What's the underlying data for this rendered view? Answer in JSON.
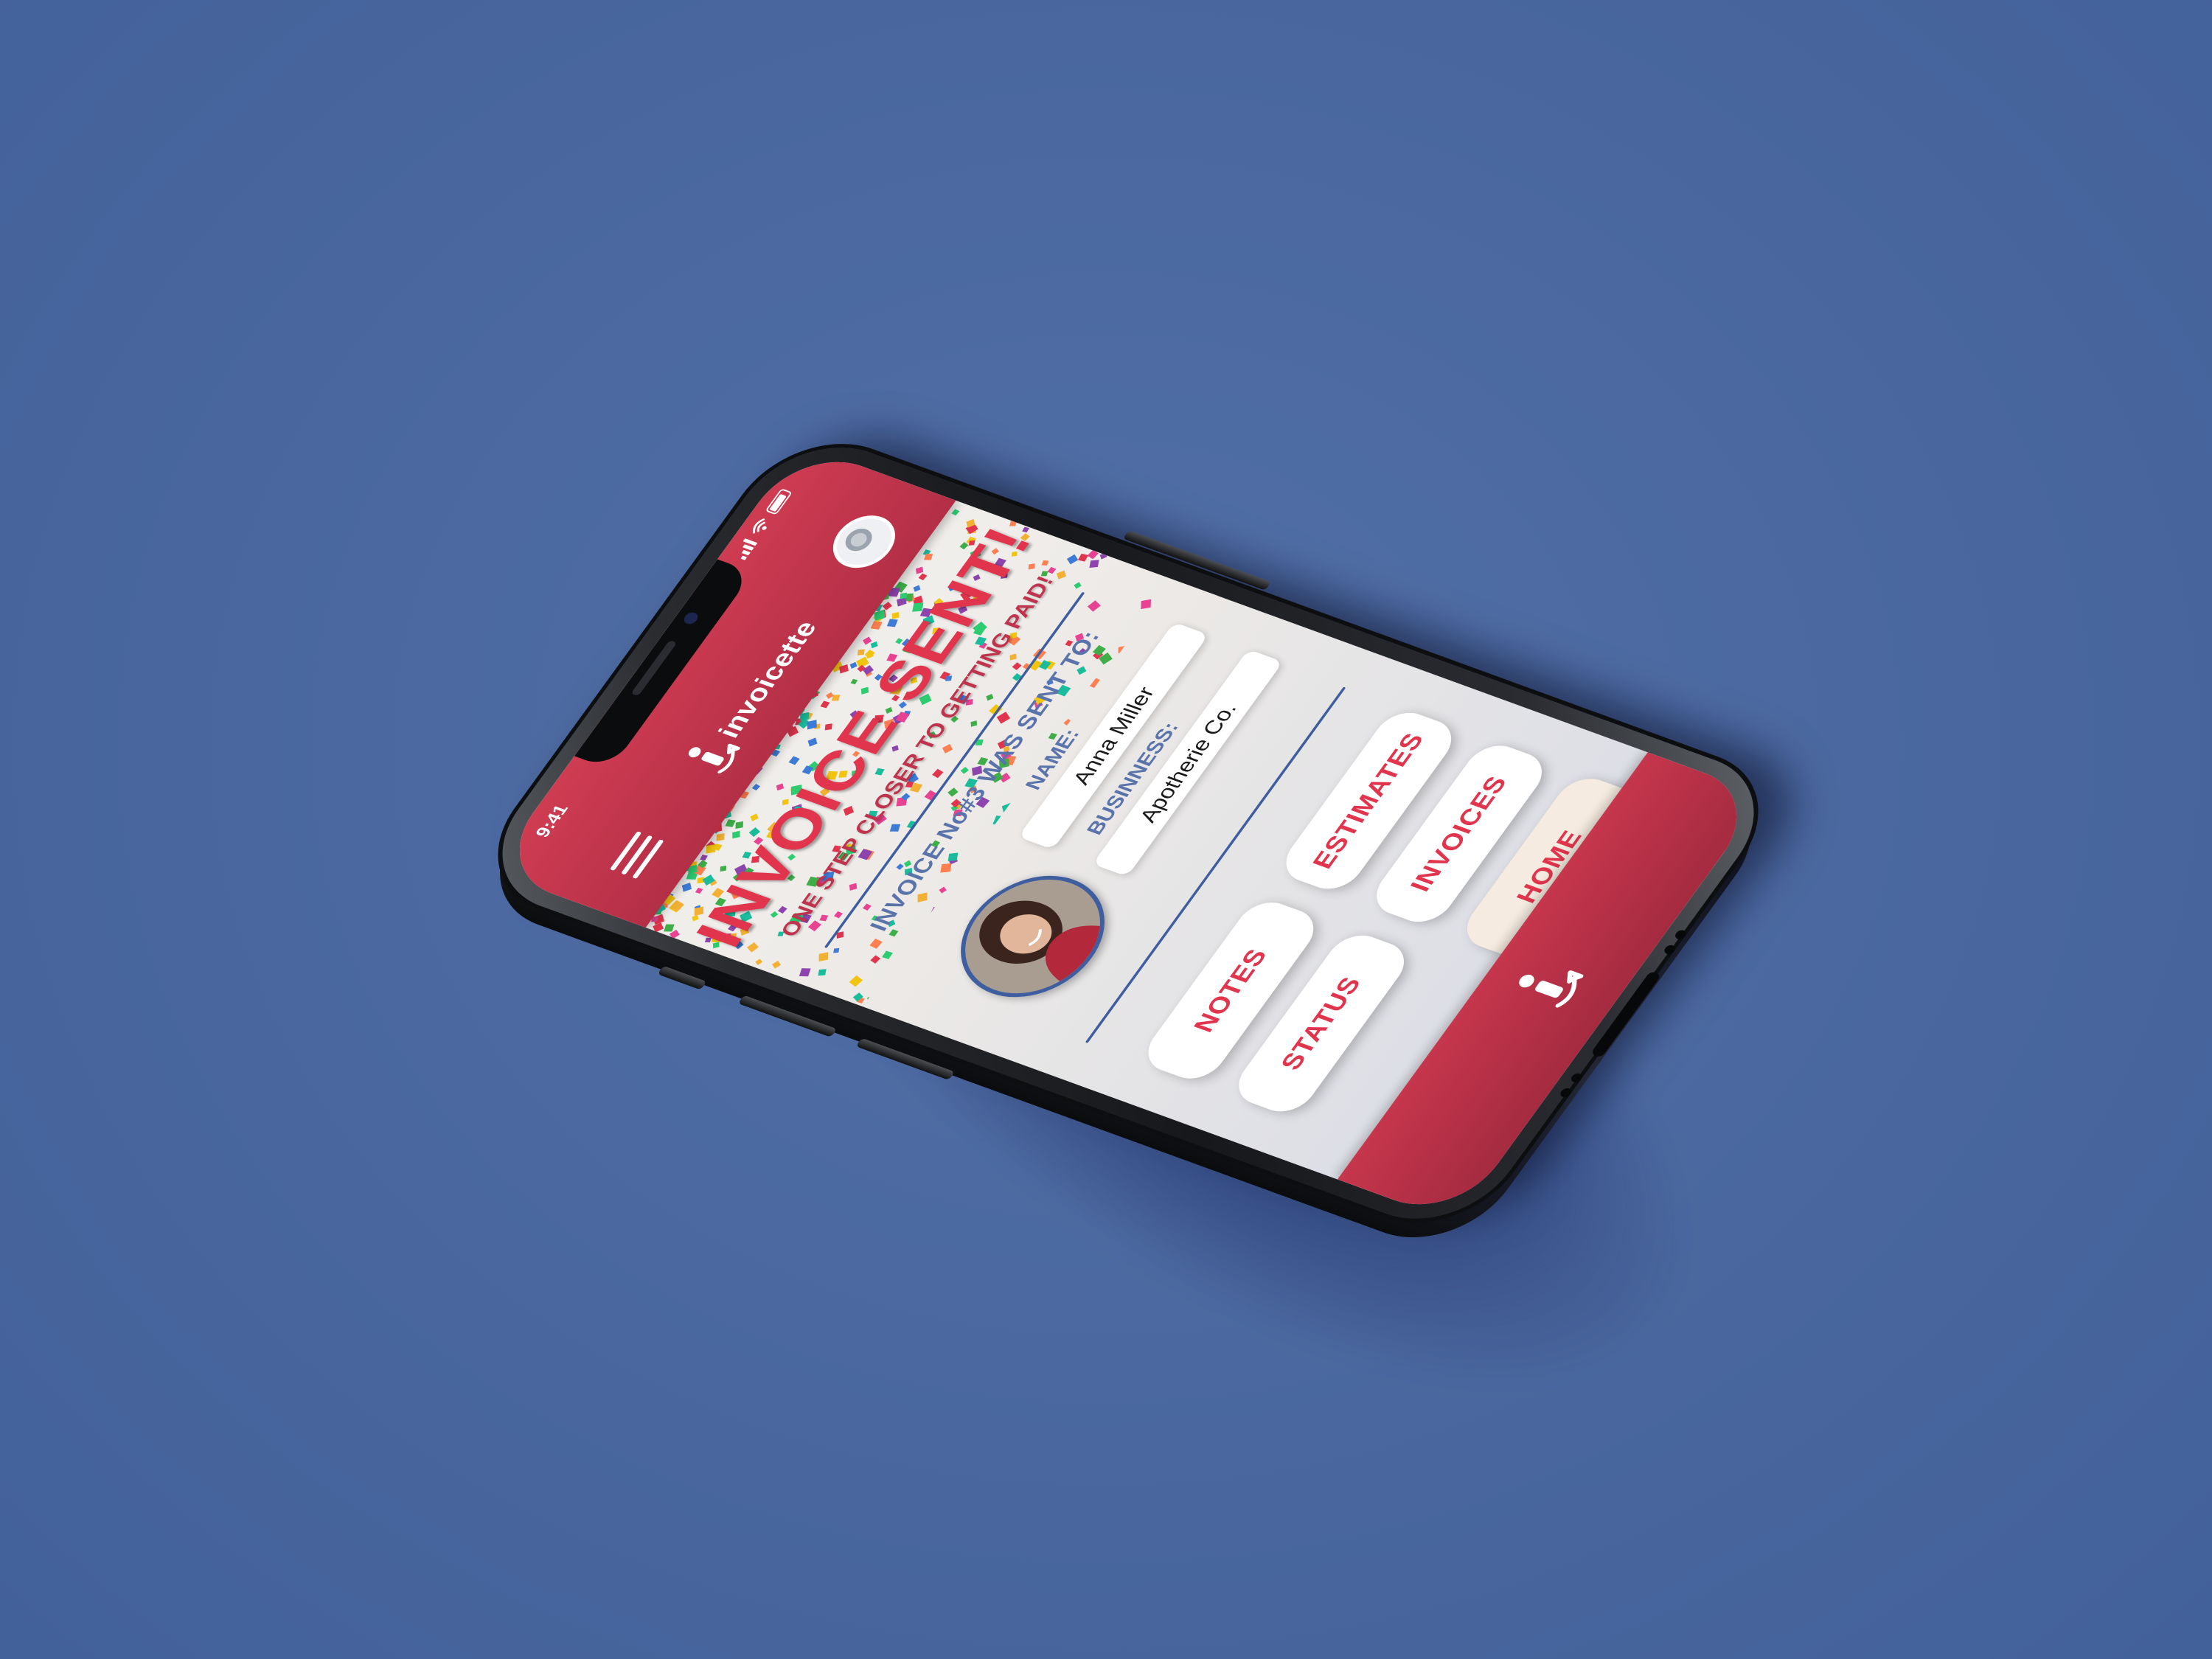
{
  "status_bar": {
    "time": "9:41"
  },
  "header": {
    "brand_name": "invoicette",
    "menu_icon": "hamburger-menu-icon",
    "avatar_icon": "user-avatar-icon"
  },
  "main": {
    "title": "INVOICE SENT!",
    "subtitle": "ONE STEP CLOSER TO GETTING PAID!",
    "sent_to_label": "INVOICE No#3 WAS SENT TO:",
    "recipient": {
      "name_label": "NAME:",
      "name_value": "Anna Miller",
      "business_label": "BUSINNESS:",
      "business_value": "Apotherie Co."
    }
  },
  "nav_buttons": [
    {
      "label": "NOTES",
      "active": false
    },
    {
      "label": "ESTIMATES",
      "active": false
    },
    {
      "label": "STATUS",
      "active": false
    },
    {
      "label": "INVOICES",
      "active": false
    },
    {
      "label": "HOME",
      "active": true
    }
  ],
  "footer": {
    "icon": "invoicette-logo-icon"
  },
  "colors": {
    "brand_red": "#cf3c52",
    "accent_blue": "#3e5e9f",
    "label_blue": "#5a74ab",
    "background": "#4a679f",
    "active_button": "#f5ebe0"
  }
}
